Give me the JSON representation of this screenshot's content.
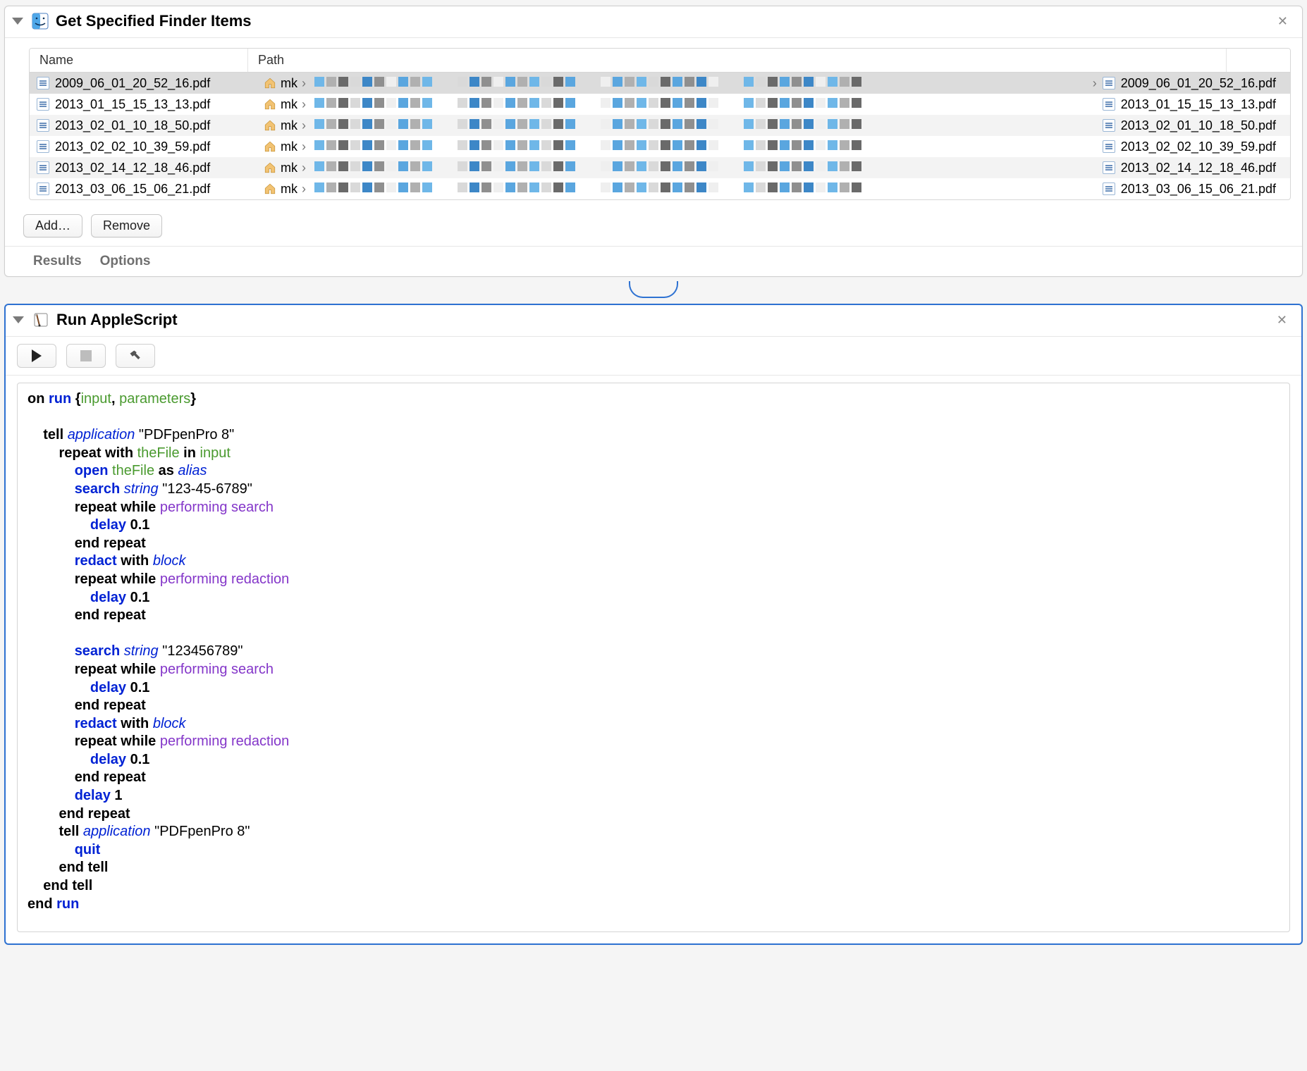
{
  "finder_action": {
    "title": "Get Specified Finder Items",
    "columns": {
      "name": "Name",
      "path": "Path"
    },
    "path_root": "mk",
    "rows": [
      {
        "file": "2009_06_01_20_52_16.pdf",
        "selected": true,
        "show_breadcrumb_file": true
      },
      {
        "file": "2013_01_15_15_13_13.pdf",
        "selected": false,
        "show_breadcrumb_file": false
      },
      {
        "file": "2013_02_01_10_18_50.pdf",
        "selected": false,
        "show_breadcrumb_file": false
      },
      {
        "file": "2013_02_02_10_39_59.pdf",
        "selected": false,
        "show_breadcrumb_file": false
      },
      {
        "file": "2013_02_14_12_18_46.pdf",
        "selected": false,
        "show_breadcrumb_file": false
      },
      {
        "file": "2013_03_06_15_06_21.pdf",
        "selected": false,
        "show_breadcrumb_file": false
      }
    ],
    "buttons": {
      "add": "Add…",
      "remove": "Remove"
    },
    "tabs": {
      "results": "Results",
      "options": "Options"
    }
  },
  "script_action": {
    "title": "Run AppleScript",
    "code_tokens": [
      [
        "kb",
        "on "
      ],
      [
        "kw",
        "run "
      ],
      [
        "kb",
        "{"
      ],
      [
        "var",
        "input"
      ],
      [
        "kb",
        ", "
      ],
      [
        "var",
        "parameters"
      ],
      [
        "kb",
        "}"
      ],
      [
        "nl",
        ""
      ],
      [
        "nl",
        ""
      ],
      [
        "sp",
        "    "
      ],
      [
        "kb",
        "tell "
      ],
      [
        "cls",
        "application"
      ],
      [
        "kb",
        " "
      ],
      [
        "str",
        "\"PDFpenPro 8\""
      ],
      [
        "nl",
        ""
      ],
      [
        "sp",
        "        "
      ],
      [
        "kb",
        "repeat with "
      ],
      [
        "var",
        "theFile"
      ],
      [
        "kb",
        " in "
      ],
      [
        "var",
        "input"
      ],
      [
        "nl",
        ""
      ],
      [
        "sp",
        "            "
      ],
      [
        "kw",
        "open "
      ],
      [
        "var",
        "theFile"
      ],
      [
        "kb",
        " as "
      ],
      [
        "cls",
        "alias"
      ],
      [
        "nl",
        ""
      ],
      [
        "sp",
        "            "
      ],
      [
        "kw",
        "search "
      ],
      [
        "cls",
        "string"
      ],
      [
        "kb",
        " "
      ],
      [
        "str",
        "\"123-45-6789\""
      ],
      [
        "nl",
        ""
      ],
      [
        "sp",
        "            "
      ],
      [
        "kb",
        "repeat while "
      ],
      [
        "prop",
        "performing search"
      ],
      [
        "nl",
        ""
      ],
      [
        "sp",
        "                "
      ],
      [
        "kw",
        "delay "
      ],
      [
        "kb",
        "0.1"
      ],
      [
        "nl",
        ""
      ],
      [
        "sp",
        "            "
      ],
      [
        "kb",
        "end repeat"
      ],
      [
        "nl",
        ""
      ],
      [
        "sp",
        "            "
      ],
      [
        "kw",
        "redact "
      ],
      [
        "kb",
        "with "
      ],
      [
        "cls",
        "block"
      ],
      [
        "nl",
        ""
      ],
      [
        "sp",
        "            "
      ],
      [
        "kb",
        "repeat while "
      ],
      [
        "prop",
        "performing redaction"
      ],
      [
        "nl",
        ""
      ],
      [
        "sp",
        "                "
      ],
      [
        "kw",
        "delay "
      ],
      [
        "kb",
        "0.1"
      ],
      [
        "nl",
        ""
      ],
      [
        "sp",
        "            "
      ],
      [
        "kb",
        "end repeat"
      ],
      [
        "nl",
        ""
      ],
      [
        "nl",
        ""
      ],
      [
        "sp",
        "            "
      ],
      [
        "kw",
        "search "
      ],
      [
        "cls",
        "string"
      ],
      [
        "kb",
        " "
      ],
      [
        "str",
        "\"123456789\""
      ],
      [
        "nl",
        ""
      ],
      [
        "sp",
        "            "
      ],
      [
        "kb",
        "repeat while "
      ],
      [
        "prop",
        "performing search"
      ],
      [
        "nl",
        ""
      ],
      [
        "sp",
        "                "
      ],
      [
        "kw",
        "delay "
      ],
      [
        "kb",
        "0.1"
      ],
      [
        "nl",
        ""
      ],
      [
        "sp",
        "            "
      ],
      [
        "kb",
        "end repeat"
      ],
      [
        "nl",
        ""
      ],
      [
        "sp",
        "            "
      ],
      [
        "kw",
        "redact "
      ],
      [
        "kb",
        "with "
      ],
      [
        "cls",
        "block"
      ],
      [
        "nl",
        ""
      ],
      [
        "sp",
        "            "
      ],
      [
        "kb",
        "repeat while "
      ],
      [
        "prop",
        "performing redaction"
      ],
      [
        "nl",
        ""
      ],
      [
        "sp",
        "                "
      ],
      [
        "kw",
        "delay "
      ],
      [
        "kb",
        "0.1"
      ],
      [
        "nl",
        ""
      ],
      [
        "sp",
        "            "
      ],
      [
        "kb",
        "end repeat"
      ],
      [
        "nl",
        ""
      ],
      [
        "sp",
        "            "
      ],
      [
        "kw",
        "delay "
      ],
      [
        "kb",
        "1"
      ],
      [
        "nl",
        ""
      ],
      [
        "sp",
        "        "
      ],
      [
        "kb",
        "end repeat"
      ],
      [
        "nl",
        ""
      ],
      [
        "sp",
        "        "
      ],
      [
        "kb",
        "tell "
      ],
      [
        "cls",
        "application"
      ],
      [
        "kb",
        " "
      ],
      [
        "str",
        "\"PDFpenPro 8\""
      ],
      [
        "nl",
        ""
      ],
      [
        "sp",
        "            "
      ],
      [
        "kw",
        "quit"
      ],
      [
        "nl",
        ""
      ],
      [
        "sp",
        "        "
      ],
      [
        "kb",
        "end tell"
      ],
      [
        "nl",
        ""
      ],
      [
        "sp",
        "    "
      ],
      [
        "kb",
        "end tell"
      ],
      [
        "nl",
        ""
      ],
      [
        "kb",
        "end "
      ],
      [
        "kw",
        "run"
      ]
    ]
  }
}
